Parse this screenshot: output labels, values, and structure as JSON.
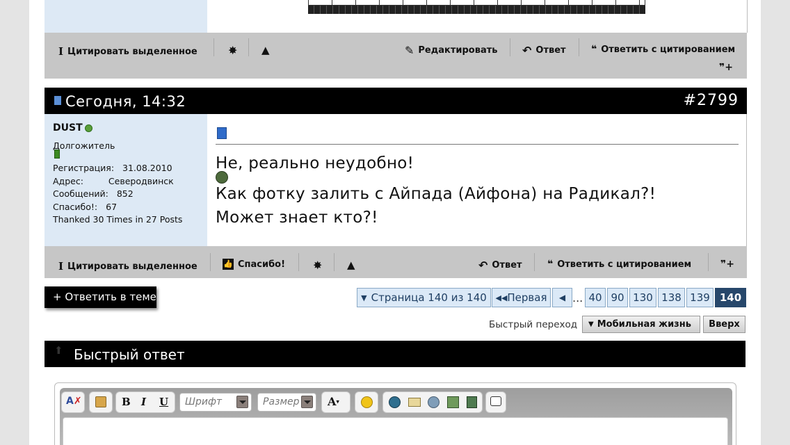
{
  "top_toolbar": {
    "quote_selected": "Цитировать выделенное",
    "edit": "Редактировать",
    "reply": "Ответ",
    "reply_quote": "Ответить с цитированием"
  },
  "post": {
    "date": "Сегодня, 14:32",
    "number": "#2799",
    "username": "DUST",
    "rank": "Долгожитель",
    "reg_label": "Регистрация:",
    "reg_value": "31.08.2010",
    "addr_label": "Адрес:",
    "addr_value": "Северодвинск",
    "msgs_label": "Сообщений:",
    "msgs_value": "852",
    "thanks_label": "Спасибо!:",
    "thanks_value": "67",
    "thanked": "Thanked 30 Times in 27 Posts",
    "line1": "Не, реально неудобно!",
    "line2": "Как фотку залить с Айпада (Айфона) на Радикал?!",
    "line3": "Может знает кто?!"
  },
  "post_toolbar": {
    "quote_selected": "Цитировать выделенное",
    "thanks": "Спасибо!",
    "reply": "Ответ",
    "reply_quote": "Ответить с цитированием"
  },
  "reply_thread_button": "+ Ответить в теме",
  "pagination": {
    "page_label": "Страница 140 из 140",
    "first": "Первая",
    "ellipsis": "...",
    "pages": [
      "40",
      "90",
      "130",
      "138",
      "139"
    ],
    "current": "140"
  },
  "quick_nav": {
    "label": "Быстрый переход",
    "forum": "Мобильная жизнь",
    "top": "Вверх"
  },
  "quick_reply": {
    "title": "Быстрый ответ",
    "font_placeholder": "Шрифт",
    "size_placeholder": "Размер"
  },
  "colors": {
    "header_black": "#000000",
    "toolbar_gray": "#c6c6c6",
    "userpanel_blue": "#dde9f5",
    "page_btn_blue": "#dbe9f7",
    "current_page": "#27476b",
    "online_green": "#5a9e3a"
  }
}
